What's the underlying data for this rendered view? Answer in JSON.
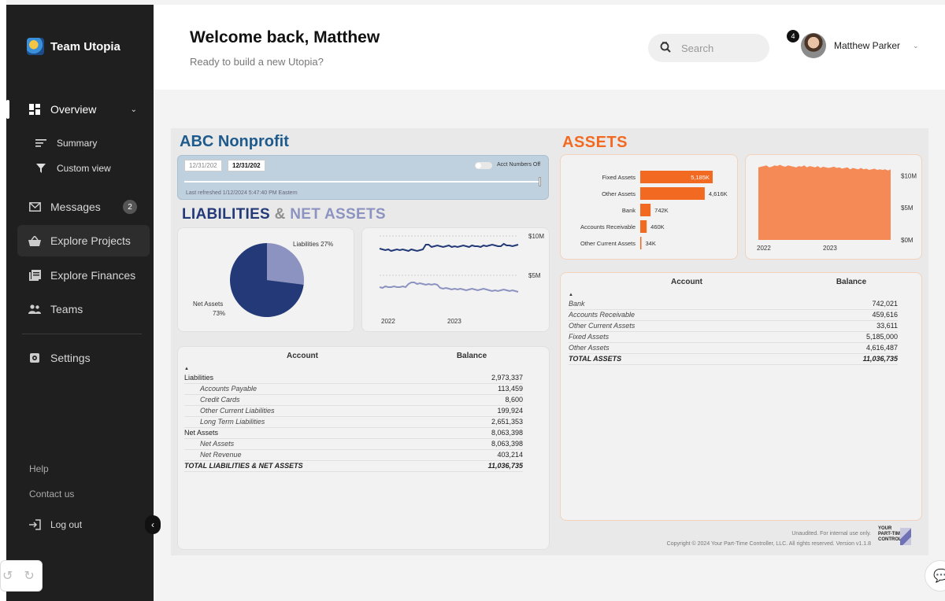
{
  "sidebar": {
    "brand": "Team Utopia",
    "overview": "Overview",
    "sub": [
      {
        "label": "Summary",
        "icon": "lines-icon"
      },
      {
        "label": "Custom view",
        "icon": "filter-icon"
      }
    ],
    "items": [
      {
        "label": "Messages",
        "icon": "mail-icon",
        "badge": "2"
      },
      {
        "label": "Explore Projects",
        "icon": "basket-icon"
      },
      {
        "label": "Explore Finances",
        "icon": "book-icon"
      },
      {
        "label": "Teams",
        "icon": "people-icon"
      }
    ],
    "settings": "Settings",
    "help": "Help",
    "contact": "Contact us",
    "logout": "Log out"
  },
  "header": {
    "welcome": "Welcome back, Matthew",
    "subtitle": "Ready to build a new Utopia?",
    "search_placeholder": "Search",
    "notifications": "4",
    "user_name": "Matthew Parker"
  },
  "dashboard": {
    "org_title": "ABC Nonprofit",
    "date_start": "12/31/202",
    "date_end": "12/31/202",
    "toggle_label": "Acct Numbers Off",
    "last_refreshed": "Last refreshed 1/12/2024 5:47:40 PM Eastern",
    "liab_title_1": "LIABILITIES",
    "liab_title_amp": "&",
    "liab_title_2": "NET ASSETS",
    "assets_title": "ASSETS",
    "footnote_1": "Unaudited. For internal use only.",
    "footnote_2": "Copyright © 2024 Your Part-Time Controller, LLC. All rights reserved. Version v1.1.8",
    "logo_lines": [
      "YOUR",
      "PART-TIME",
      "CONTROLLER"
    ]
  },
  "liab_table": {
    "headers": [
      "Account",
      "Balance"
    ],
    "rows": [
      {
        "account": "Liabilities",
        "balance": "2,973,337",
        "level": 0
      },
      {
        "account": "Accounts Payable",
        "balance": "113,459",
        "level": 1
      },
      {
        "account": "Credit Cards",
        "balance": "8,600",
        "level": 1
      },
      {
        "account": "Other Current Liabilities",
        "balance": "199,924",
        "level": 1
      },
      {
        "account": "Long Term Liabilities",
        "balance": "2,651,353",
        "level": 1
      },
      {
        "account": "Net Assets",
        "balance": "8,063,398",
        "level": 0
      },
      {
        "account": "Net Assets",
        "balance": "8,063,398",
        "level": 1
      },
      {
        "account": "Net Revenue",
        "balance": "403,214",
        "level": 1
      },
      {
        "account": "TOTAL LIABILITIES & NET ASSETS",
        "balance": "11,036,735",
        "level": 2
      }
    ]
  },
  "assets_table": {
    "headers": [
      "Account",
      "Balance"
    ],
    "rows": [
      {
        "account": "Bank",
        "balance": "742,021",
        "level": 1
      },
      {
        "account": "Accounts Receivable",
        "balance": "459,616",
        "level": 1
      },
      {
        "account": "Other Current Assets",
        "balance": "33,611",
        "level": 1
      },
      {
        "account": "Fixed Assets",
        "balance": "5,185,000",
        "level": 1
      },
      {
        "account": "Other Assets",
        "balance": "4,616,487",
        "level": 1
      },
      {
        "account": "TOTAL ASSETS",
        "balance": "11,036,735",
        "level": 2
      }
    ]
  },
  "chart_data": [
    {
      "type": "pie",
      "labels": [
        "Liabilities",
        "Net Assets"
      ],
      "values": [
        27,
        73
      ],
      "label_texts": [
        "Liabilities 27%",
        "Net Assets",
        "73%"
      ],
      "colors": [
        "#8d93c0",
        "#243a78"
      ]
    },
    {
      "type": "line",
      "x_ticks": [
        "2022",
        "2023"
      ],
      "y_ticks": [
        "$10M",
        "$5M"
      ],
      "ylim": [
        0,
        10
      ],
      "series": [
        {
          "color": "#243a78",
          "values": [
            8.4,
            8.3,
            8.2,
            8.3,
            8.1,
            8.2,
            8.3,
            8.2,
            8.3,
            8.2,
            8.1,
            8.3,
            8.2,
            8.1,
            8.2,
            8.3,
            8.9,
            8.9,
            8.6,
            8.7,
            8.8,
            8.7,
            8.6,
            8.7,
            8.8,
            8.6,
            8.7,
            8.6,
            8.7,
            8.8,
            8.7,
            8.6,
            8.8,
            8.7,
            8.7,
            8.6,
            8.8,
            8.7,
            8.8,
            8.9,
            8.8,
            8.7,
            8.7,
            9.0,
            8.8,
            8.8,
            8.7,
            8.8,
            8.9
          ]
        },
        {
          "color": "#8d93c0",
          "values": [
            3.5,
            3.4,
            3.6,
            3.5,
            3.5,
            3.6,
            3.5,
            3.5,
            3.6,
            3.5,
            3.9,
            4.1,
            4.1,
            3.9,
            4.0,
            3.9,
            3.8,
            3.9,
            3.8,
            3.9,
            3.8,
            3.4,
            3.3,
            3.4,
            3.3,
            3.2,
            3.3,
            3.2,
            3.3,
            3.2,
            3.1,
            3.2,
            3.3,
            3.2,
            3.1,
            3.2,
            3.3,
            3.2,
            3.1,
            3.0,
            3.1,
            3.0,
            3.1,
            3.2,
            3.1,
            3.0,
            3.1,
            3.0,
            2.9
          ]
        }
      ]
    },
    {
      "type": "bar",
      "categories": [
        "Fixed Assets",
        "Other Assets",
        "Bank",
        "Accounts Receivable",
        "Other Current Assets"
      ],
      "values": [
        5185,
        4616,
        742,
        460,
        34
      ],
      "labels": [
        "5,185K",
        "4,616K",
        "742K",
        "460K",
        "34K"
      ],
      "color": "#f26a21"
    },
    {
      "type": "area",
      "x_ticks": [
        "2022",
        "2023"
      ],
      "y_ticks": [
        "$10M",
        "$5M",
        "$0M"
      ],
      "ylim": [
        0,
        12
      ],
      "color": "#f58a57",
      "values": [
        11.3,
        11.4,
        11.5,
        11.6,
        11.3,
        11.4,
        11.6,
        11.5,
        11.7,
        11.5,
        11.4,
        11.6,
        11.5,
        11.4,
        11.3,
        11.5,
        11.4,
        11.6,
        11.3,
        11.5,
        11.4,
        11.3,
        11.5,
        11.2,
        11.4,
        11.3,
        11.2,
        11.3,
        11.4,
        11.2,
        11.3,
        11.1,
        11.2,
        11.3,
        11.0,
        11.2,
        11.1,
        11.0,
        11.2,
        11.0,
        11.1,
        10.9,
        11.0,
        11.1,
        10.9,
        11.0,
        10.9,
        11.0,
        10.8,
        11.0
      ]
    }
  ]
}
